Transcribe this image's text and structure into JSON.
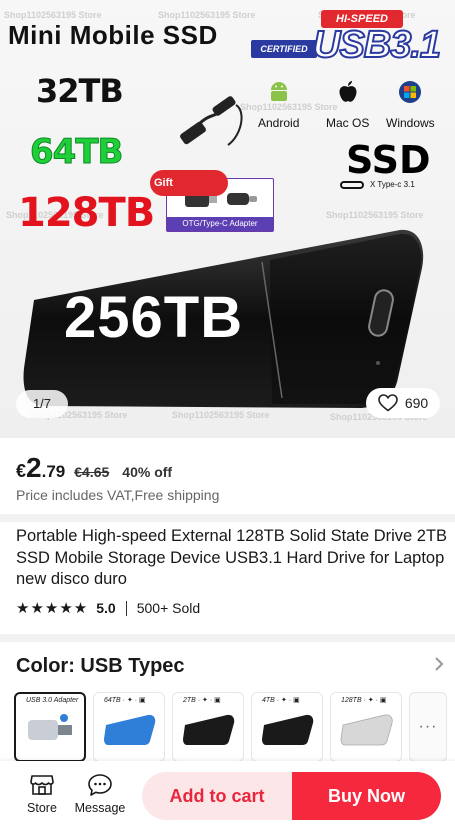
{
  "hero": {
    "watermark": "Shop1102563195 Store",
    "title": "Mini Mobile SSD",
    "badge_speed": "HI-SPEED",
    "badge_certified": "CERTIFIED",
    "badge_usb": "USB3.1",
    "capacities": [
      "32TB",
      "64TB",
      "128TB"
    ],
    "os_list": [
      {
        "label": "Android",
        "icon": "android-icon"
      },
      {
        "label": "Mac OS",
        "icon": "apple-icon"
      },
      {
        "label": "Windows",
        "icon": "windows-icon"
      }
    ],
    "ssd_label": "SSD",
    "typec_label": "X  Type-c  3.1",
    "gift_label": "Gift",
    "adapter_label": "OTG/Type-C Adapter",
    "drive_capacity": "256TB",
    "image_index": "1/7",
    "like_count": "690"
  },
  "price": {
    "currency": "€",
    "integer": "2",
    "decimal": ".79",
    "original": "€4.65",
    "discount": "40% off",
    "note": "Price includes VAT,Free shipping"
  },
  "product": {
    "title": "Portable High-speed External 128TB Solid State Drive 2TB SSD Mobile Storage Device USB3.1 Hard Drive for Laptop new disco duro",
    "stars": "★★★★★",
    "rating": "5.0",
    "sold": "500+ Sold"
  },
  "variant": {
    "label": "Color: USB Typec",
    "swatches": [
      {
        "caption": "USB 3.0 Adapter",
        "color": "#9aa3b0"
      },
      {
        "caption": "64TB · ✦ · ▣",
        "color": "#2f7fd8"
      },
      {
        "caption": "2TB · ✦ · ▣",
        "color": "#1a1a1a"
      },
      {
        "caption": "4TB · ✦ · ▣",
        "color": "#1a1a1a"
      },
      {
        "caption": "128TB · ✦ · ▣",
        "color": "#d7d7d7"
      }
    ],
    "more": "···"
  },
  "bottom_bar": {
    "store": "Store",
    "message": "Message",
    "add_to_cart": "Add to cart",
    "buy_now": "Buy Now"
  },
  "colors": {
    "accent": "#f5283e",
    "accent_light": "#fde6e8"
  }
}
